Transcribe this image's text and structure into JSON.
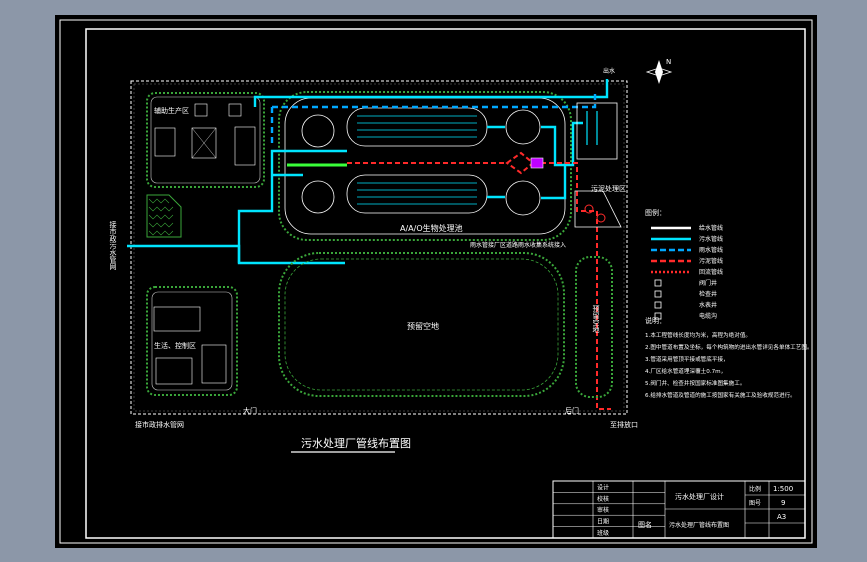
{
  "drawing": {
    "title": "污水处理厂管线布置图",
    "north_label": "N"
  },
  "zones": {
    "aux_production": "辅助生产区",
    "aao_pool": "A/A/O生物处理池",
    "sludge_zone": "污泥处理区",
    "reserved_land": "预留空地",
    "reserved_land_right": "预留空地",
    "life_control": "生活、控制区"
  },
  "road_labels": {
    "main_gate": "大门",
    "side_gate": "后门",
    "outfall": "至排放口",
    "inflow": "接市政污水管网",
    "drain": "接市政排水管网",
    "outflow": "出水"
  },
  "pipe_labels": {
    "rain_note": "雨水管接厂区道路雨水收集系统接入"
  },
  "legend": {
    "title": "图例：",
    "items": [
      {
        "label": "给水管线",
        "color": "#ffffff",
        "style": "solid"
      },
      {
        "label": "污水管线",
        "color": "#00e5ff",
        "style": "solid"
      },
      {
        "label": "雨水管线",
        "color": "#00a8ff",
        "style": "dashed"
      },
      {
        "label": "污泥管线",
        "color": "#ff2a2a",
        "style": "dashed"
      },
      {
        "label": "回流管线",
        "color": "#ff2a2a",
        "style": "dotted"
      },
      {
        "label": "阀门井",
        "color": "#ffffff",
        "style": "symbol"
      },
      {
        "label": "检查井",
        "color": "#ffffff",
        "style": "symbol"
      },
      {
        "label": "水表井",
        "color": "#ffffff",
        "style": "symbol"
      },
      {
        "label": "电缆沟",
        "color": "#ffffff",
        "style": "symbol"
      }
    ]
  },
  "notes": {
    "title": "说明：",
    "lines": [
      "1.本工程管线长度均为米，高程为绝对值。",
      "2.图中管道布置及坐标，每个构筑物的进出水管详见各单体工艺图。",
      "3.管道采用管顶平接或管底平接，",
      "4.厂区给水管道埋深覆土0.7m，",
      "5.阀门井、检查井按国家标准图集施工。",
      "6.给排水管道及管道的施工按国家有关施工及验收规范进行。"
    ]
  },
  "title_block": {
    "scale_label": "比例",
    "scale_value": "1:500",
    "sheet_label": "图号",
    "sheet_value": "9",
    "size_value": "A3",
    "project": "污水处理厂设计",
    "drawing_name_label": "图名",
    "drawing_name": "污水处理厂管线布置图",
    "rows": [
      "设计",
      "校核",
      "审核",
      "日期",
      "班级"
    ]
  }
}
